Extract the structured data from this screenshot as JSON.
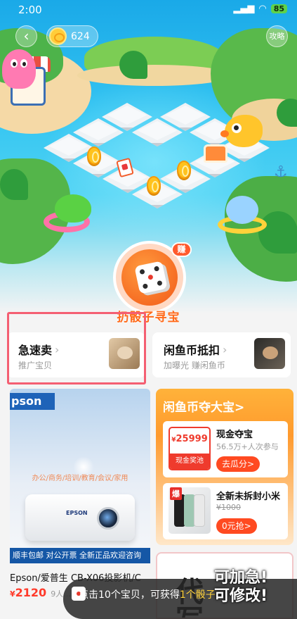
{
  "status_bar": {
    "time": "2:00",
    "battery": "85"
  },
  "header": {
    "coin_count": "624",
    "guide_label": "攻略"
  },
  "game": {
    "earn_badge": "赚",
    "roll_label": "扔骰子寻宝"
  },
  "quick_actions": [
    {
      "title": "急速卖",
      "subtitle": "推广宝贝"
    },
    {
      "title": "闲鱼币抵扣",
      "subtitle": "加曝光 赚闲鱼币"
    }
  ],
  "feed": {
    "left_item": {
      "brand": "pson",
      "uses": "办公/商务/培训/教育/会议/家用",
      "logo_text": "EPSON",
      "promo": "顺丰包邮 对公开票 全新正品欢迎咨询",
      "title": "Epson/爱普生 CB-X06投影机/C",
      "price_symbol": "¥",
      "price": "2120",
      "wants": "9人…"
    },
    "trade_panel": {
      "title": "闲鱼币夺大宝",
      "chevron": ">",
      "items": [
        {
          "ticket_value": "25999",
          "ticket_currency": "¥",
          "ticket_label": "现金奖池",
          "title": "现金夺宝",
          "subtitle": "56.5万+人次参与",
          "button": "去瓜分>"
        },
        {
          "badge": "爆",
          "title": "全新未拆封小米",
          "subtitle": "¥1000",
          "button": "0元抢>"
        }
      ]
    }
  },
  "toast": {
    "prefix": "点击10个宝贝，可获得",
    "highlight": "1个骰子"
  },
  "overlay_tip": {
    "line1": "可加急!",
    "line2": "可修改!"
  },
  "colors": {
    "accent": "#ff6a1a",
    "price": "#ff3a2a",
    "highlight_box": "#f45f72"
  }
}
